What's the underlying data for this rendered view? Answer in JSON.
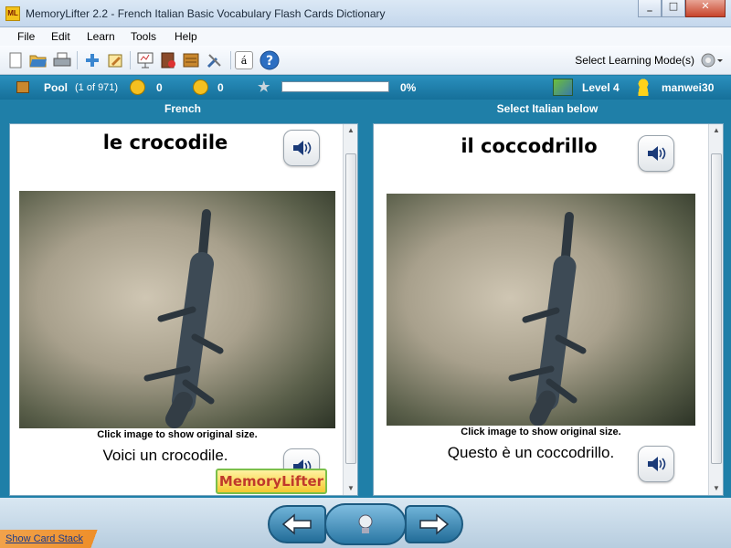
{
  "window": {
    "title": "MemoryLifter 2.2 - French Italian Basic Vocabulary Flash Cards Dictionary",
    "app_icon_text": "ML",
    "buttons": [
      "minimize",
      "maximize",
      "close"
    ]
  },
  "menu": {
    "items": [
      "File",
      "Edit",
      "Learn",
      "Tools",
      "Help"
    ]
  },
  "toolbar": {
    "icons": [
      "new-file-icon",
      "open-folder-icon",
      "print-icon",
      "add-card-icon",
      "edit-card-icon",
      "presentation-icon",
      "dictionary-icon",
      "card-stack-icon",
      "tools-icon",
      "font-icon",
      "help-icon"
    ],
    "mode_label": "Select Learning Mode(s)"
  },
  "status": {
    "pool_label": "Pool",
    "pool_count": "(1 of 971)",
    "correct_count": "0",
    "wrong_count": "0",
    "progress_fraction": 0.0,
    "progress_text": "0%",
    "level": "Level 4",
    "user": "manwei30"
  },
  "cards": {
    "left_header": "French",
    "right_header": "Select Italian below",
    "left": {
      "word": "le crocodile",
      "caption": "Click image to show original size.",
      "sentence": "Voici un crocodile."
    },
    "right": {
      "word": "il coccodrillo",
      "caption": "Click image to show original size.",
      "sentence": "Questo è un coccodrillo."
    },
    "logo_text": "MemoryLifter"
  },
  "bottom": {
    "show_stack": "Show Card Stack"
  },
  "colors": {
    "accent": "#1f7fa8",
    "status_bar": "#16709a",
    "nav_button": "#236d99"
  }
}
